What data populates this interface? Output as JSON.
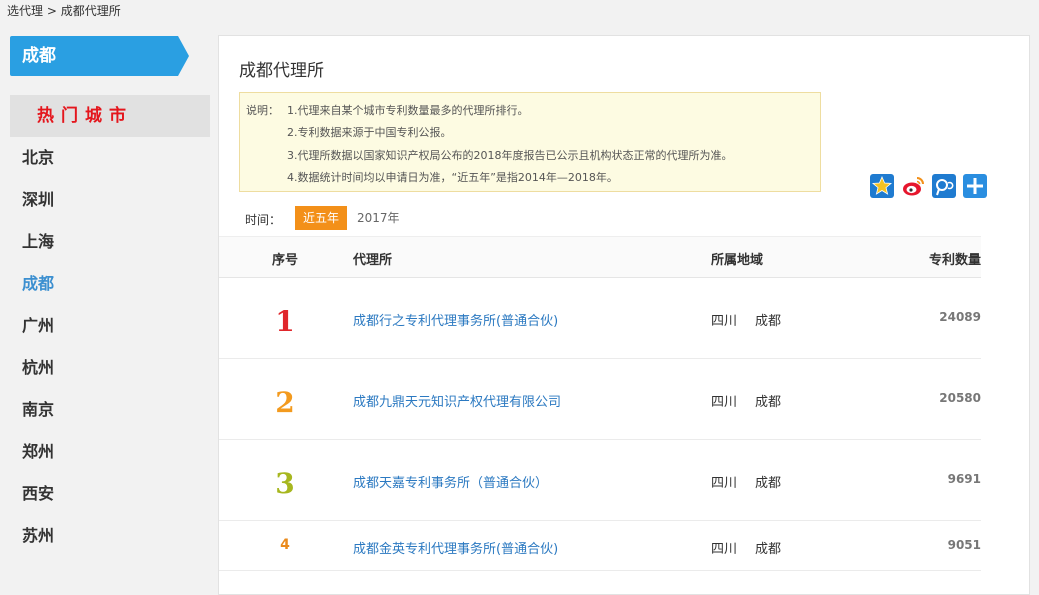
{
  "breadcrumb": {
    "parent": "选代理",
    "separator": " > ",
    "current": "成都代理所"
  },
  "sidebar": {
    "current_city": "成都",
    "hot_title": "热门城市",
    "cities": [
      "北京",
      "深圳",
      "上海",
      "成都",
      "广州",
      "杭州",
      "南京",
      "郑州",
      "西安",
      "苏州"
    ],
    "active_city": "成都"
  },
  "panel": {
    "title": "成都代理所",
    "notes": {
      "label": "说明：",
      "lines": [
        "1.代理来自某个城市专利数量最多的代理所排行。",
        "2.专利数据来源于中国专利公报。",
        "3.代理所数据以国家知识产权局公布的2018年度报告已公示且机构状态正常的代理所为准。",
        "4.数据统计时间均以申请日为准，“近五年”是指2014年—2018年。"
      ]
    },
    "share_icons": [
      "favorite-star-icon",
      "sina-weibo-icon",
      "tencent-weibo-icon",
      "more-share-icon"
    ],
    "time": {
      "label": "时间：",
      "options": [
        "近五年",
        "2017年"
      ],
      "selected": "近五年"
    },
    "table": {
      "headers": {
        "rank": "序号",
        "agency": "代理所",
        "region": "所属地域",
        "count": "专利数量"
      },
      "rows": [
        {
          "rank": "1",
          "agency": "成都行之专利代理事务所(普通合伙)",
          "province": "四川",
          "city": "成都",
          "count": "24089"
        },
        {
          "rank": "2",
          "agency": "成都九鼎天元知识产权代理有限公司",
          "province": "四川",
          "city": "成都",
          "count": "20580"
        },
        {
          "rank": "3",
          "agency": "成都天嘉专利事务所（普通合伙）",
          "province": "四川",
          "city": "成都",
          "count": "9691"
        },
        {
          "rank": "4",
          "agency": "成都金英专利代理事务所(普通合伙)",
          "province": "四川",
          "city": "成都",
          "count": "9051"
        }
      ],
      "rank_colors": [
        "#e0262b",
        "#f39a1e",
        "#a7b71f"
      ]
    }
  }
}
